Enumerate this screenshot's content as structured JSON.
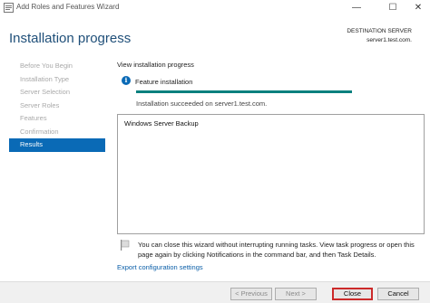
{
  "window": {
    "title": "Add Roles and Features Wizard",
    "controls": {
      "minimize": "—",
      "maximize": "☐",
      "close": "✕"
    }
  },
  "header": {
    "page_title": "Installation progress",
    "destination_label": "DESTINATION SERVER",
    "destination_server": "server1.test.com."
  },
  "nav": {
    "items": [
      {
        "label": "Before You Begin",
        "active": false
      },
      {
        "label": "Installation Type",
        "active": false
      },
      {
        "label": "Server Selection",
        "active": false
      },
      {
        "label": "Server Roles",
        "active": false
      },
      {
        "label": "Features",
        "active": false
      },
      {
        "label": "Confirmation",
        "active": false
      },
      {
        "label": "Results",
        "active": true
      }
    ]
  },
  "main": {
    "section_label": "View installation progress",
    "info_icon_glyph": "i",
    "feature_installation_label": "Feature installation",
    "progress_fraction": 1.0,
    "install_status": "Installation succeeded on server1.test.com.",
    "results": [
      "Windows Server Backup"
    ],
    "note": "You can close this wizard without interrupting running tasks. View task progress or open this page again by clicking Notifications in the command bar, and then Task Details.",
    "export_link": "Export configuration settings"
  },
  "footer": {
    "previous": "< Previous",
    "next": "Next >",
    "close": "Close",
    "cancel": "Cancel"
  },
  "colors": {
    "accent": "#0a6ab6",
    "title": "#1f4f79",
    "progress": "#06807e",
    "highlight": "#cc2a2a"
  }
}
